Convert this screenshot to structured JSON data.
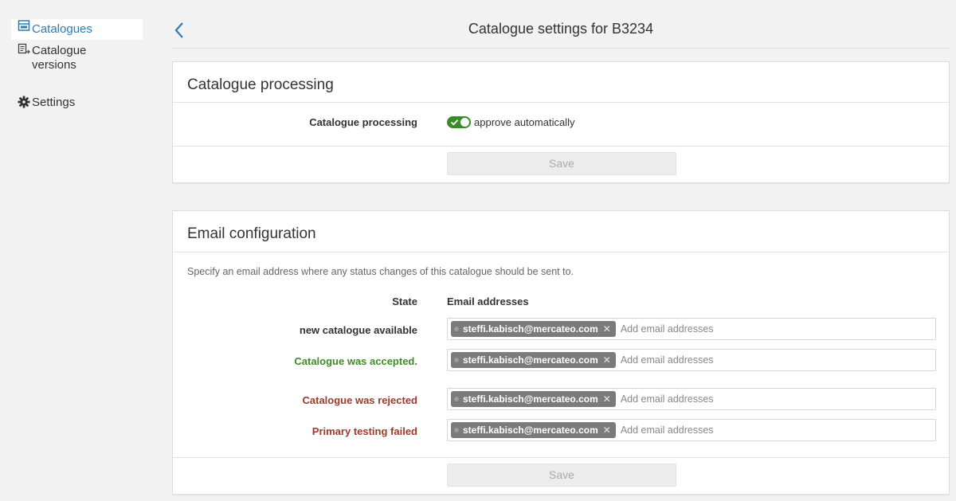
{
  "sidebar": {
    "items": [
      {
        "label": "Catalogues",
        "icon": "catalogue-icon",
        "active": true
      },
      {
        "label": "Catalogue versions",
        "icon": "catalogue-versions-icon",
        "active": false
      },
      {
        "label": "Settings",
        "icon": "gear-icon",
        "active": false
      }
    ]
  },
  "header": {
    "title": "Catalogue settings for B3234",
    "back_icon": "chevron-left-icon"
  },
  "processing": {
    "title": "Catalogue processing",
    "label": "Catalogue processing",
    "toggle_label": "approve automatically",
    "toggle_on": true,
    "save_label": "Save"
  },
  "email": {
    "title": "Email configuration",
    "hint": "Specify an email address where any status changes of this catalogue should be sent to.",
    "col_state": "State",
    "col_emails": "Email addresses",
    "placeholder": "Add email addresses",
    "rows": [
      {
        "state": "new catalogue available",
        "email": "steffi.kabisch@mercateo.com"
      },
      {
        "state": "Catalogue was accepted.",
        "email": "steffi.kabisch@mercateo.com"
      },
      {
        "state": "Catalogue was rejected",
        "email": "steffi.kabisch@mercateo.com"
      },
      {
        "state": "Primary testing failed",
        "email": "steffi.kabisch@mercateo.com"
      }
    ],
    "save_label": "Save"
  },
  "colors": {
    "accent": "#2e7bb4",
    "toggle_on": "#3a8a2a",
    "state_accepted": "#3f8a2a",
    "state_rejected": "#9b3a2c",
    "chip_bg": "#7b7b7b"
  }
}
